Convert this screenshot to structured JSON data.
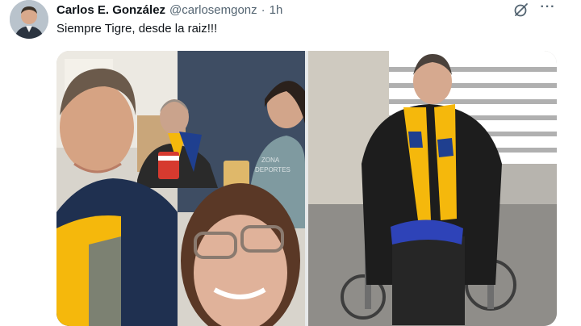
{
  "tweet": {
    "author_name": "Carlos E. González",
    "handle": "@carlosemgonz",
    "separator": "·",
    "time": "1h",
    "text": "Siempre Tigre, desde la raiz!!!",
    "more_label": "···"
  },
  "media": {
    "photo_1": {
      "watermark_line1": "ZONA",
      "watermark_line2": "DEPORTES"
    },
    "photo_2": {}
  },
  "icons": {
    "grok": "grok-icon",
    "more": "more-options-icon",
    "avatar": "avatar"
  },
  "colors": {
    "text": "#0f1419",
    "secondary": "#536471",
    "tigres_gold": "#f5b80c",
    "tigres_blue": "#1f3f8f"
  }
}
